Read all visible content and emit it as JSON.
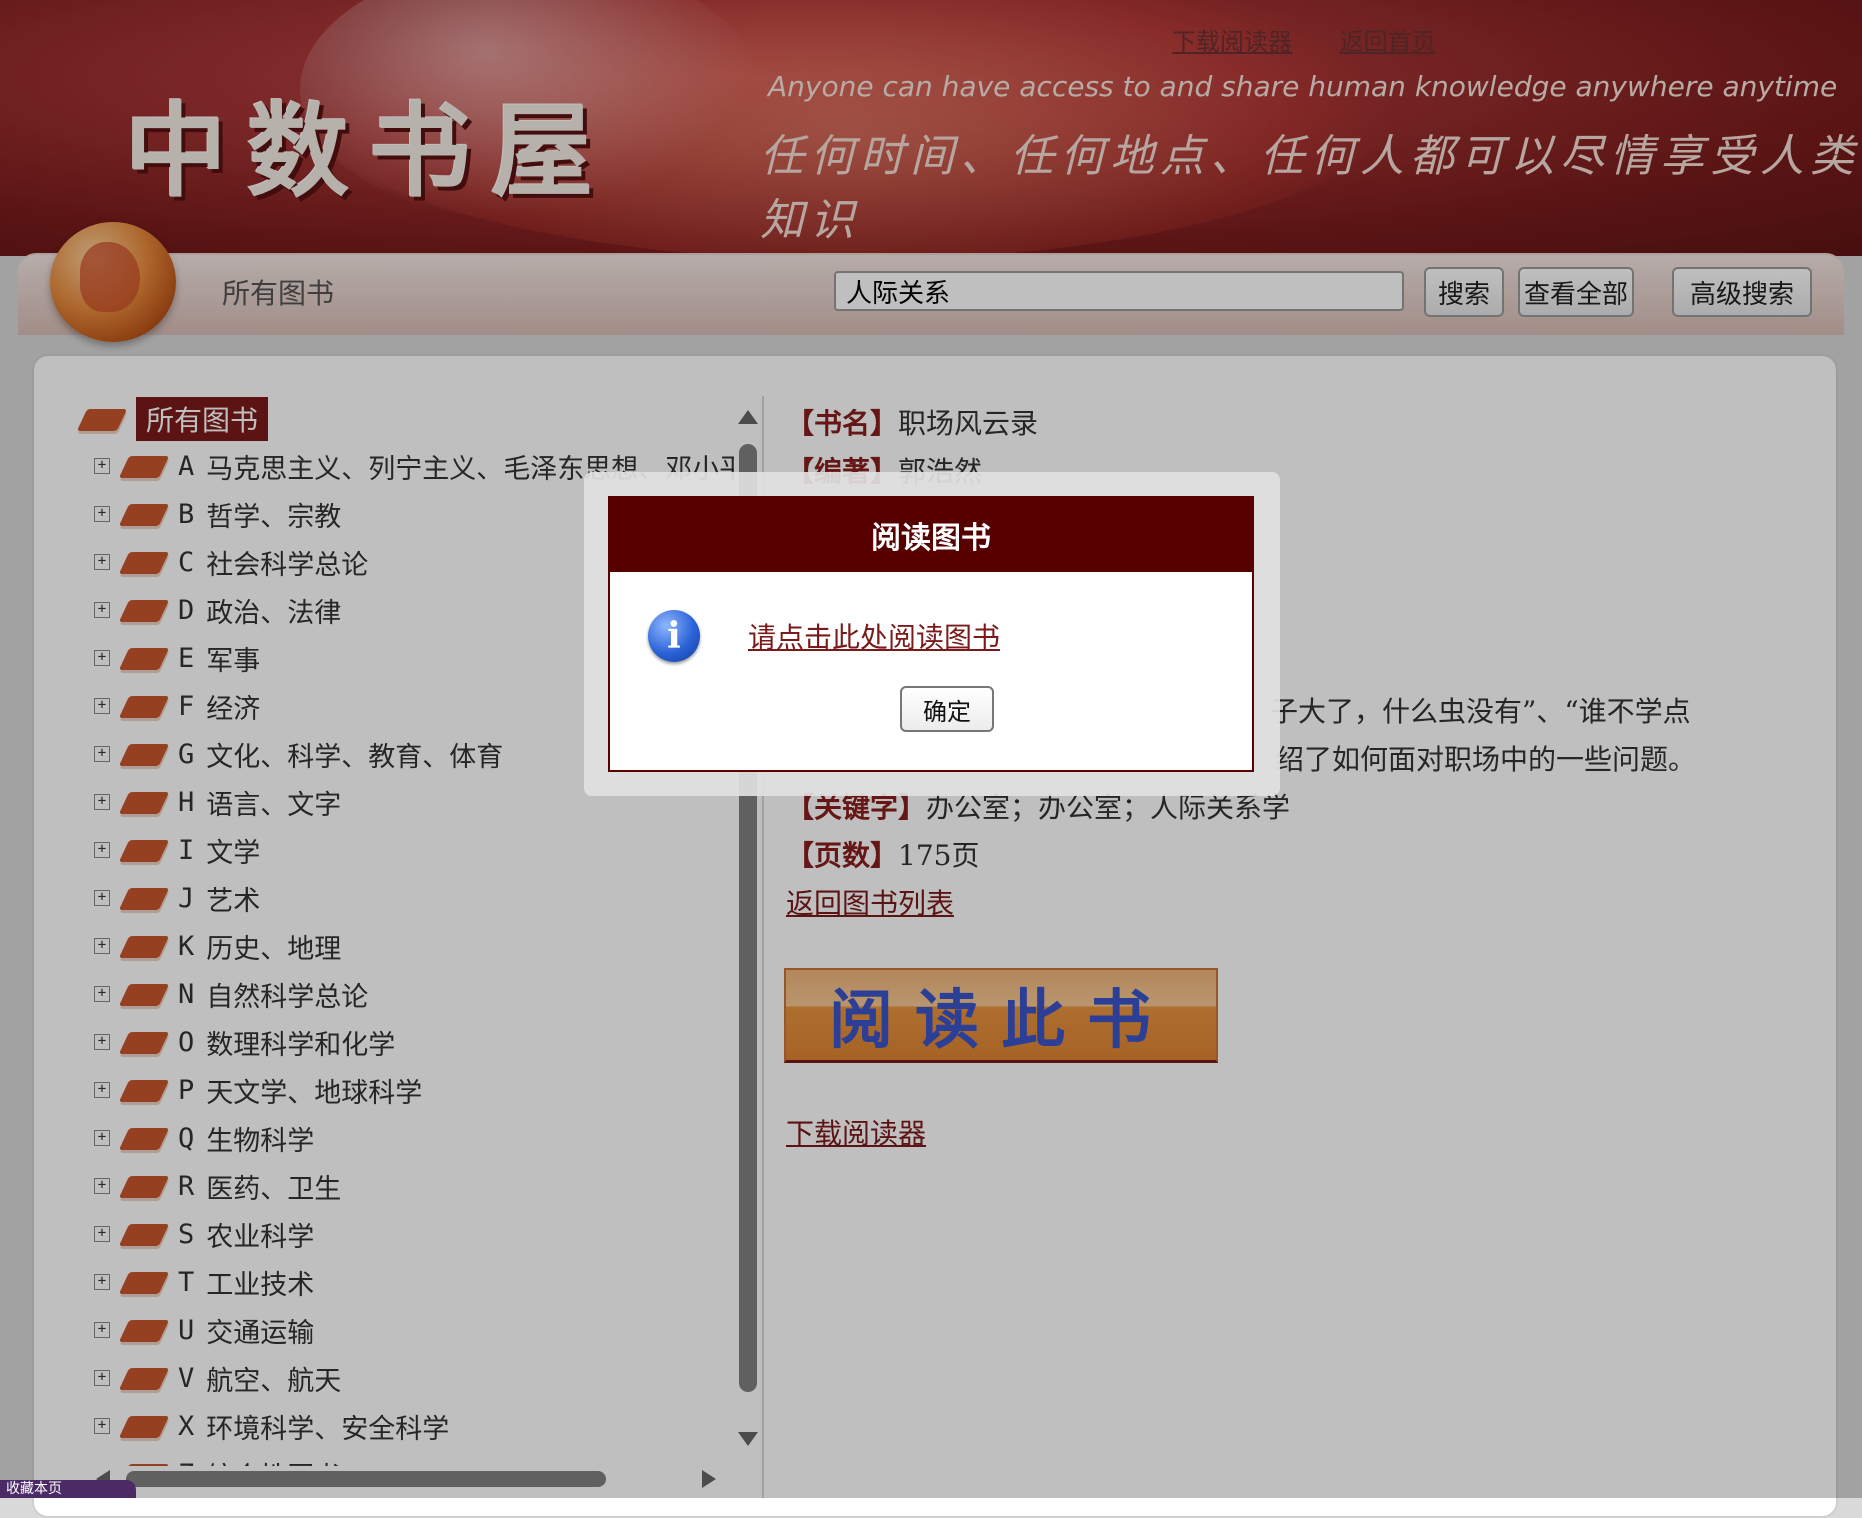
{
  "banner": {
    "brand": "中数书屋",
    "slogan_en": "Anyone can have access to and share human knowledge anywhere anytime",
    "slogan_cn": "任何时间、任何地点、任何人都可以尽情享受人类知识",
    "top_links": [
      "下载阅读器",
      "返回首页"
    ]
  },
  "search": {
    "section_title": "所有图书",
    "query": "人际关系",
    "buttons": [
      "搜索",
      "查看全部",
      "高级搜索"
    ]
  },
  "tree": {
    "root": "所有图书",
    "items": [
      {
        "letter": "A",
        "label": "马克思主义、列宁主义、毛泽东思想、邓小平理论"
      },
      {
        "letter": "B",
        "label": "哲学、宗教"
      },
      {
        "letter": "C",
        "label": "社会科学总论"
      },
      {
        "letter": "D",
        "label": "政治、法律"
      },
      {
        "letter": "E",
        "label": "军事"
      },
      {
        "letter": "F",
        "label": "经济"
      },
      {
        "letter": "G",
        "label": "文化、科学、教育、体育"
      },
      {
        "letter": "H",
        "label": "语言、文字"
      },
      {
        "letter": "I",
        "label": "文学"
      },
      {
        "letter": "J",
        "label": "艺术"
      },
      {
        "letter": "K",
        "label": "历史、地理"
      },
      {
        "letter": "N",
        "label": "自然科学总论"
      },
      {
        "letter": "O",
        "label": "数理科学和化学"
      },
      {
        "letter": "P",
        "label": "天文学、地球科学"
      },
      {
        "letter": "Q",
        "label": "生物科学"
      },
      {
        "letter": "R",
        "label": "医药、卫生"
      },
      {
        "letter": "S",
        "label": "农业科学"
      },
      {
        "letter": "T",
        "label": "工业技术"
      },
      {
        "letter": "U",
        "label": "交通运输"
      },
      {
        "letter": "V",
        "label": "航空、航天"
      },
      {
        "letter": "X",
        "label": "环境科学、安全科学"
      },
      {
        "letter": "Z",
        "label": "综合性图书"
      }
    ]
  },
  "detail": {
    "title_label": "【书名】",
    "title": "职场风云录",
    "author_label": "【编著】",
    "author": "郭浩然",
    "summary_line1": "子大了，什么虫没有”、“谁不学点",
    "summary_line2": "绍了如何面对职场中的一些问题。",
    "keywords_label": "【关键字】",
    "keywords": "办公室；办公室；人际关系学",
    "pages_label": "【页数】",
    "pages": "175页",
    "back_link": "返回图书列表",
    "read_button": "阅读此书",
    "download_link": "下载阅读器"
  },
  "modal": {
    "title": "阅读图书",
    "link": "请点击此处阅读图书",
    "ok": "确定",
    "icon": "info-icon"
  },
  "corner_tab": "收藏本页"
}
